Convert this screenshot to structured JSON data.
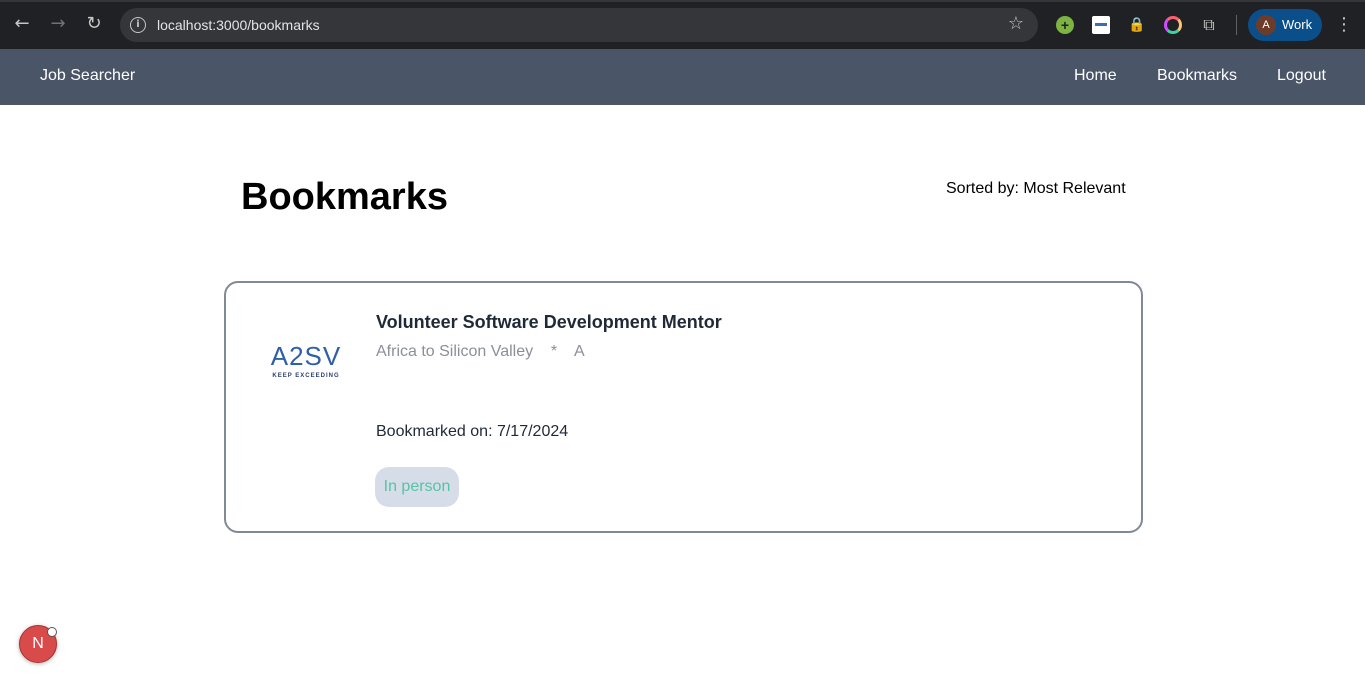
{
  "browser": {
    "url": "localhost:3000/bookmarks",
    "profile_initial": "A",
    "profile_label": "Work"
  },
  "navbar": {
    "brand": "Job Searcher",
    "links": [
      "Home",
      "Bookmarks",
      "Logout"
    ]
  },
  "page": {
    "title": "Bookmarks",
    "sorted_by": "Sorted by: Most Relevant"
  },
  "bookmarks": [
    {
      "title": "Volunteer Software Development Mentor",
      "company": "Africa to Silicon Valley",
      "separator": "*",
      "location": "A",
      "bookmarked_on": "Bookmarked on: 7/17/2024",
      "tag": "In person",
      "logo_text": "A2SV",
      "logo_tagline": "KEEP EXCEEDING"
    }
  ],
  "dev_badge": "N",
  "colors": {
    "navbar_bg": "#4a5568",
    "tag_bg": "#d6dde8",
    "tag_text": "#56c3a5",
    "card_border": "#808a96"
  }
}
